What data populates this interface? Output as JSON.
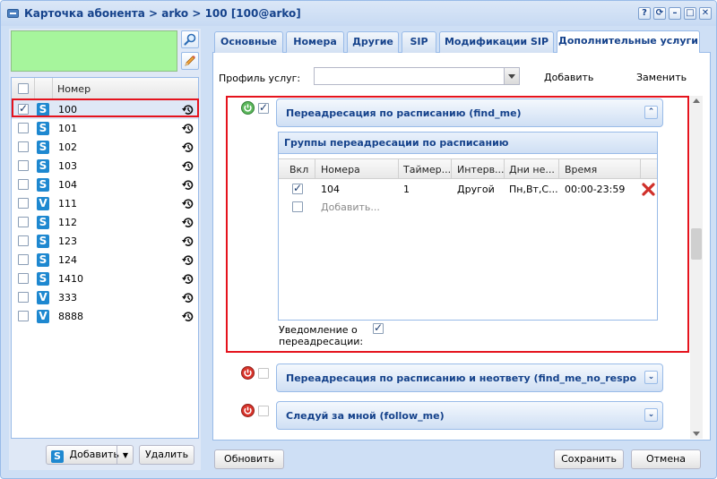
{
  "window": {
    "title": "Карточка абонента > arko > 100 [100@arko]",
    "buttons": [
      "?",
      "⟳",
      "–",
      "□",
      "✕"
    ]
  },
  "left": {
    "list_header": "Номер",
    "rows": [
      {
        "type": "S",
        "number": "100",
        "checked": true,
        "selected": true
      },
      {
        "type": "S",
        "number": "101",
        "checked": false
      },
      {
        "type": "S",
        "number": "102",
        "checked": false
      },
      {
        "type": "S",
        "number": "103",
        "checked": false
      },
      {
        "type": "S",
        "number": "104",
        "checked": false
      },
      {
        "type": "V",
        "number": "111",
        "checked": false
      },
      {
        "type": "S",
        "number": "112",
        "checked": false
      },
      {
        "type": "S",
        "number": "123",
        "checked": false
      },
      {
        "type": "S",
        "number": "124",
        "checked": false
      },
      {
        "type": "S",
        "number": "1410",
        "checked": false
      },
      {
        "type": "V",
        "number": "333",
        "checked": false
      },
      {
        "type": "V",
        "number": "8888",
        "checked": false
      }
    ],
    "add_button": "Добавить",
    "delete_button": "Удалить"
  },
  "tabs": [
    {
      "label": "Основные",
      "active": false
    },
    {
      "label": "Номера",
      "active": false
    },
    {
      "label": "Другие",
      "active": false
    },
    {
      "label": "SIP",
      "active": false
    },
    {
      "label": "Модификации SIP",
      "active": false
    },
    {
      "label": "Дополнительные услуги",
      "active": true
    }
  ],
  "services": {
    "profile_label": "Профиль услуг:",
    "profile_value": "",
    "add_link": "Добавить",
    "replace_link": "Заменить",
    "find_me": {
      "title": "Переадресация по расписанию (find_me)",
      "enabled": true,
      "checked": true,
      "groups_title": "Группы переадресации по расписанию",
      "columns": [
        "Вкл",
        "Номера",
        "Таймер...",
        "Интерв...",
        "Дни не...",
        "Время"
      ],
      "rows": [
        {
          "enabled": true,
          "number": "104",
          "timer": "1",
          "interval": "Другой",
          "days": "Пн,Вт,С...",
          "time": "00:00-23:59"
        }
      ],
      "add_row_placeholder": "Добавить...",
      "notify_label_1": "Уведомление о",
      "notify_label_2": "переадресации:",
      "notify_checked": true
    },
    "find_me_no_response": {
      "title": "Переадресация по расписанию и неответу (find_me_no_respo",
      "enabled": false
    },
    "follow_me": {
      "title": "Следуй за мной (follow_me)",
      "enabled": false
    }
  },
  "footer": {
    "refresh": "Обновить",
    "save": "Сохранить",
    "cancel": "Отмена"
  }
}
